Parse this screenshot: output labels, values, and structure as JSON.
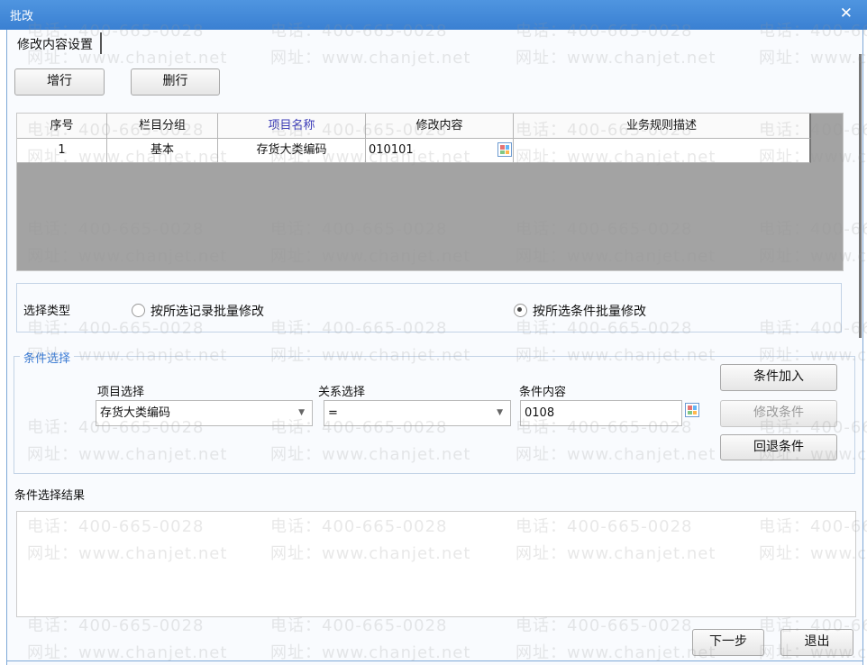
{
  "window": {
    "title": "批改",
    "close_icon": "close-icon"
  },
  "tab": {
    "label": "修改内容设置"
  },
  "toolbar": {
    "add_row": "增行",
    "delete_row": "删行"
  },
  "grid": {
    "columns": [
      "序号",
      "栏目分组",
      "项目名称",
      "修改内容",
      "业务规则描述"
    ],
    "highlight_column_color": "#3b3bb8",
    "rows": [
      {
        "no": "1",
        "group": "基本",
        "item": "存货大类编码",
        "content": "010101",
        "rule": ""
      }
    ]
  },
  "selection_type": {
    "label": "选择类型",
    "options": [
      {
        "label": "按所选记录批量修改",
        "checked": false
      },
      {
        "label": "按所选条件批量修改",
        "checked": true
      }
    ]
  },
  "condition": {
    "legend": "条件选择",
    "item_label": "项目选择",
    "item_value": "存货大类编码",
    "relation_label": "关系选择",
    "relation_value": "=",
    "content_label": "条件内容",
    "content_value": "0108",
    "add_button": "条件加入",
    "modify_button": "修改条件",
    "undo_button": "回退条件"
  },
  "result": {
    "label": "条件选择结果",
    "value": ""
  },
  "footer": {
    "next_button": "下一步",
    "exit_button": "退出"
  },
  "watermark": {
    "phone": "电话：400-665-0028",
    "site": "网址：www.chanjet.net"
  },
  "colors": {
    "titlebar": "#3f87d6",
    "legend": "#3a7bd5"
  }
}
